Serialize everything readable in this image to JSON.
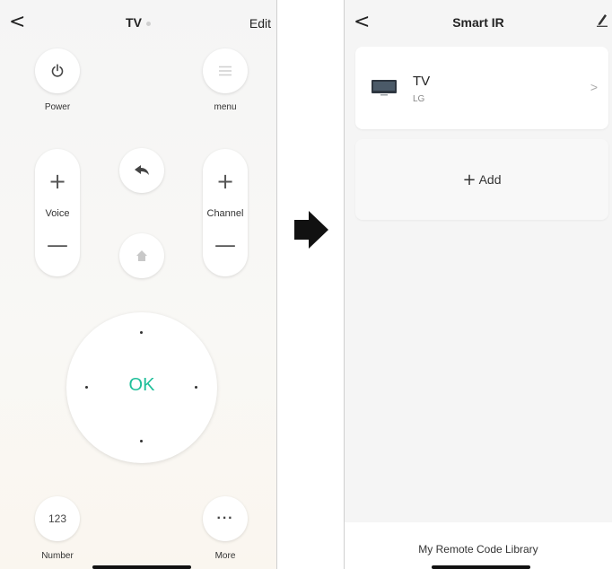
{
  "left": {
    "header": {
      "back_glyph": "<",
      "title": "TV",
      "edit_label": "Edit"
    },
    "buttons": {
      "power_label": "Power",
      "menu_label": "menu",
      "voice_label": "Voice",
      "channel_label": "Channel",
      "plus_glyph": "+",
      "minus_glyph": "—",
      "ok_label": "OK",
      "number_text": "123",
      "number_label": "Number",
      "more_glyph": "···",
      "more_label": "More"
    },
    "icons": [
      "back-icon",
      "power-icon",
      "menu-icon",
      "return-icon",
      "home-icon",
      "more-icon"
    ]
  },
  "right": {
    "header": {
      "back_glyph": "<",
      "title": "Smart IR"
    },
    "device": {
      "name": "TV",
      "brand": "LG",
      "chevron": ">"
    },
    "add": {
      "plus_glyph": "+",
      "label": "Add"
    },
    "footer": {
      "link": "My Remote Code Library"
    },
    "icons": [
      "back-icon",
      "pencil-icon",
      "tv-icon",
      "chevron-right-icon"
    ]
  },
  "colors": {
    "accent": "#1fbf9a",
    "arrow": "#111111"
  }
}
